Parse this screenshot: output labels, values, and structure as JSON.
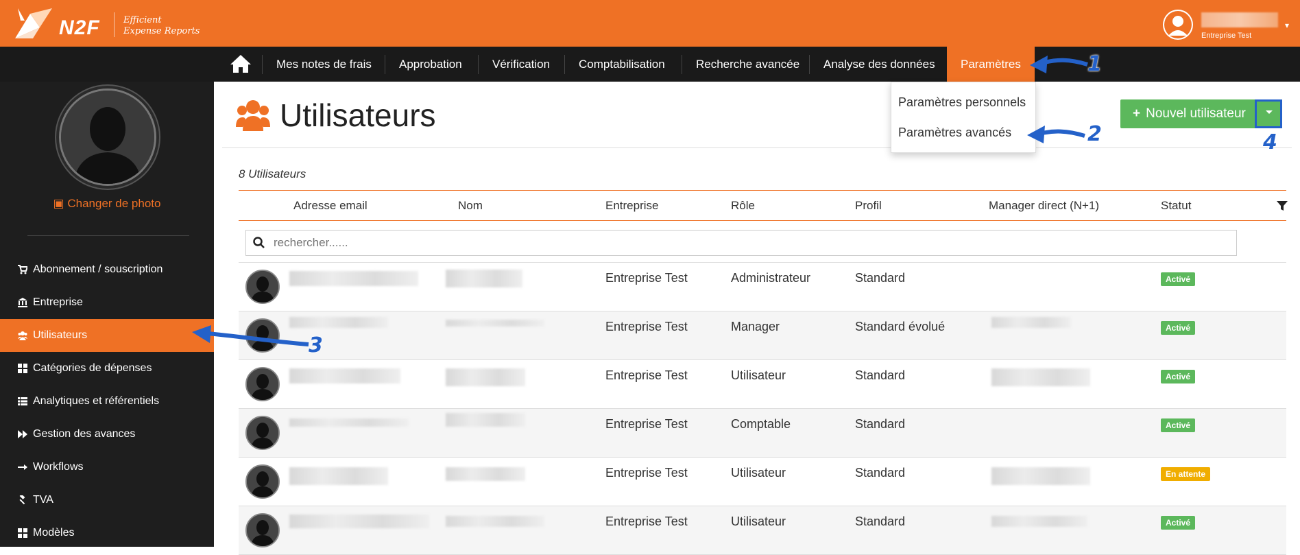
{
  "header": {
    "brand": "N2F",
    "tagline_line1": "Efficient",
    "tagline_line2": "Expense Reports",
    "user_company": "Entreprise Test"
  },
  "nav": {
    "items": [
      {
        "label": "Mes notes de frais"
      },
      {
        "label": "Approbation"
      },
      {
        "label": "Vérification"
      },
      {
        "label": "Comptabilisation"
      },
      {
        "label": "Recherche avancée"
      },
      {
        "label": "Analyse des données"
      },
      {
        "label": "Paramètres"
      }
    ]
  },
  "dropdown": {
    "items": [
      {
        "label": "Paramètres personnels"
      },
      {
        "label": "Paramètres avancés"
      }
    ]
  },
  "sidebar": {
    "change_photo": "Changer de photo",
    "items": [
      {
        "label": "Abonnement / souscription",
        "icon": "cart-icon"
      },
      {
        "label": "Entreprise",
        "icon": "bank-icon"
      },
      {
        "label": "Utilisateurs",
        "icon": "users-icon"
      },
      {
        "label": "Catégories de dépenses",
        "icon": "grid-icon"
      },
      {
        "label": "Analytiques et référentiels",
        "icon": "list-icon"
      },
      {
        "label": "Gestion des avances",
        "icon": "fast-forward-icon"
      },
      {
        "label": "Workflows",
        "icon": "arrow-right-icon"
      },
      {
        "label": "TVA",
        "icon": "gavel-icon"
      },
      {
        "label": "Modèles",
        "icon": "grid-icon"
      }
    ]
  },
  "main": {
    "title": "Utilisateurs",
    "new_user_label": "Nouvel utilisateur",
    "count_label": "8 Utilisateurs",
    "search_placeholder": "rechercher......",
    "columns": {
      "email": "Adresse email",
      "name": "Nom",
      "company": "Entreprise",
      "role": "Rôle",
      "profile": "Profil",
      "manager": "Manager direct (N+1)",
      "status": "Statut"
    },
    "rows": [
      {
        "company": "Entreprise Test",
        "role": "Administrateur",
        "profile": "Standard",
        "status": "Activé"
      },
      {
        "company": "Entreprise Test",
        "role": "Manager",
        "profile": "Standard évolué",
        "status": "Activé"
      },
      {
        "company": "Entreprise Test",
        "role": "Utilisateur",
        "profile": "Standard",
        "status": "Activé"
      },
      {
        "company": "Entreprise Test",
        "role": "Comptable",
        "profile": "Standard",
        "status": "Activé"
      },
      {
        "company": "Entreprise Test",
        "role": "Utilisateur",
        "profile": "Standard",
        "status": "En attente"
      },
      {
        "company": "Entreprise Test",
        "role": "Utilisateur",
        "profile": "Standard",
        "status": "Activé"
      }
    ]
  },
  "annotations": [
    "1",
    "2",
    "3",
    "4"
  ],
  "colors": {
    "brand_orange": "#ef7125",
    "nav_dark": "#1a1a1a",
    "success_green": "#5cb85c",
    "pending_yellow": "#f0ad00",
    "annotation_blue": "#2461c9"
  }
}
